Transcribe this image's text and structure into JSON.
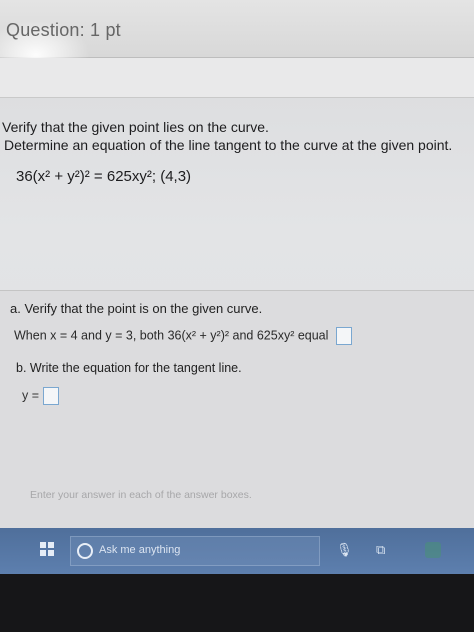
{
  "header": {
    "question_label": "Question: 1 pt"
  },
  "problem": {
    "line1": "Verify that the given point lies on the curve.",
    "line2": "Determine an equation of the line tangent to the curve at the given point.",
    "equation": "36(x² + y²)² = 625xy²; (4,3)"
  },
  "part_a": {
    "heading": "a. Verify that the point is on the given curve.",
    "statement": "When x = 4 and y = 3, both 36(x² + y²)² and 625xy² equal",
    "answer_value": ""
  },
  "part_b": {
    "heading": "b. Write the equation for the tangent line.",
    "y_label": "y =",
    "answer_value": ""
  },
  "hint": "Enter your answer in each of the answer boxes.",
  "taskbar": {
    "search_placeholder": "Ask me anything",
    "icons": [
      "windows-icon",
      "cortana-circle-icon",
      "microphone-icon",
      "task-view-icon"
    ]
  },
  "colors": {
    "taskbar": "#5d7fae",
    "answer_box_border": "#7aa7d0",
    "page_bg": "#dedfe1"
  }
}
